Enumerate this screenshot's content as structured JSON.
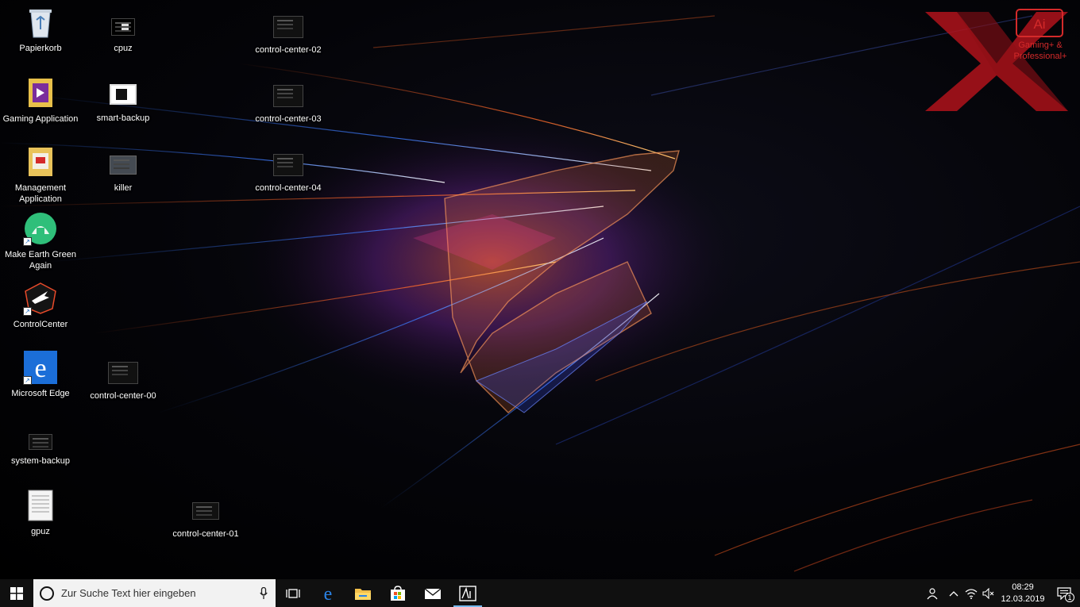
{
  "desktop": {
    "icons": {
      "recycle": {
        "label": "Papierkorb"
      },
      "cpuz": {
        "label": "cpuz"
      },
      "cc02": {
        "label": "control-center-02"
      },
      "gaming": {
        "label": "Gaming Application"
      },
      "smartbackup": {
        "label": "smart-backup"
      },
      "cc03": {
        "label": "control-center-03"
      },
      "management": {
        "label": "Management Application"
      },
      "killer": {
        "label": "killer"
      },
      "cc04": {
        "label": "control-center-04"
      },
      "earth": {
        "label": "Make Earth Green Again"
      },
      "controlcenter": {
        "label": "ControlCenter"
      },
      "edge": {
        "label": "Microsoft Edge"
      },
      "cc00": {
        "label": "control-center-00"
      },
      "sysbackup": {
        "label": "system-backup"
      },
      "gpuz": {
        "label": "gpuz"
      },
      "cc01": {
        "label": "control-center-01"
      }
    }
  },
  "brand": {
    "tagline": "Gaming+ & Professional+",
    "badge": "Ai",
    "color": "#c0161c"
  },
  "taskbar": {
    "search_placeholder": "Zur Suche Text hier eingeben",
    "apps": [
      "task-view-icon",
      "edge-icon",
      "file-explorer-icon",
      "store-icon",
      "mail-icon",
      "aorus-ai-icon"
    ],
    "active_app": "aorus-ai-icon",
    "time": "08:29",
    "date": "12.03.2019",
    "notification_count": "1"
  }
}
